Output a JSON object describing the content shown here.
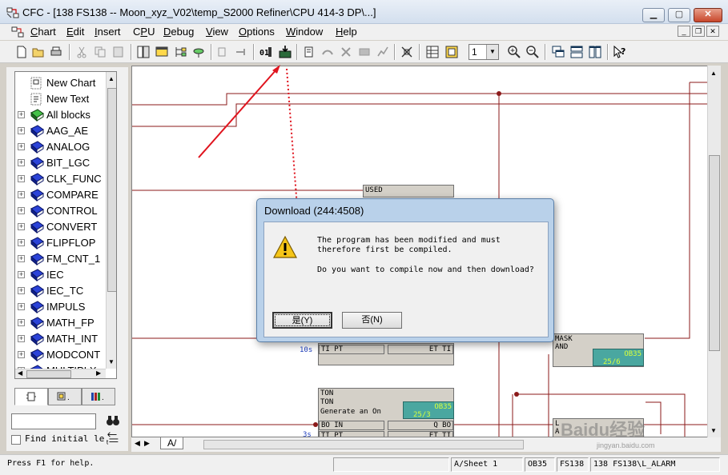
{
  "window": {
    "title": "CFC - [138 FS138 -- Moon_xyz_V02\\temp_S2000 Refiner\\CPU 414-3 DP\\...]",
    "minimize": "▁",
    "maximize": "▢",
    "close": "✕"
  },
  "menu": [
    {
      "label": "Chart",
      "ul": "C"
    },
    {
      "label": "Edit",
      "ul": "E"
    },
    {
      "label": "Insert",
      "ul": "I"
    },
    {
      "label": "CPU",
      "ul": "P"
    },
    {
      "label": "Debug",
      "ul": "D"
    },
    {
      "label": "View",
      "ul": "V"
    },
    {
      "label": "Options",
      "ul": "O"
    },
    {
      "label": "Window",
      "ul": "W"
    },
    {
      "label": "Help",
      "ul": "H"
    }
  ],
  "toolbar": {
    "zoom_select_value": "1",
    "icons": [
      "new-icon",
      "open-icon",
      "print-icon",
      "cut-icon",
      "copy-icon",
      "paste-icon",
      "catalog-icon",
      "overview-icon",
      "structure-icon",
      "link-icon",
      "connect-icon",
      "compile-icon",
      "download-icon",
      "monitor-icon",
      "test-icon",
      "zoom-in-icon",
      "zoom-out-icon",
      "cascade-icon",
      "tile-horizontal-icon",
      "tile-vertical-icon",
      "help-cursor-icon"
    ]
  },
  "tree": {
    "items": [
      {
        "label": "New Chart",
        "icon": "chart-icon",
        "expandable": false
      },
      {
        "label": "New Text",
        "icon": "text-icon",
        "expandable": false
      },
      {
        "label": "All blocks",
        "icon": "book-green-icon",
        "expandable": true
      },
      {
        "label": "AAG_AE",
        "icon": "book-blue-icon",
        "expandable": true
      },
      {
        "label": "ANALOG",
        "icon": "book-blue-icon",
        "expandable": true
      },
      {
        "label": "BIT_LGC",
        "icon": "book-blue-icon",
        "expandable": true
      },
      {
        "label": "CLK_FUNC",
        "icon": "book-blue-icon",
        "expandable": true
      },
      {
        "label": "COMPARE",
        "icon": "book-blue-icon",
        "expandable": true
      },
      {
        "label": "CONTROL",
        "icon": "book-blue-icon",
        "expandable": true
      },
      {
        "label": "CONVERT",
        "icon": "book-blue-icon",
        "expandable": true
      },
      {
        "label": "FLIPFLOP",
        "icon": "book-blue-icon",
        "expandable": true
      },
      {
        "label": "FM_CNT_1",
        "icon": "book-blue-icon",
        "expandable": true
      },
      {
        "label": "IEC",
        "icon": "book-blue-icon",
        "expandable": true
      },
      {
        "label": "IEC_TC",
        "icon": "book-blue-icon",
        "expandable": true
      },
      {
        "label": "IMPULS",
        "icon": "book-blue-icon",
        "expandable": true
      },
      {
        "label": "MATH_FP",
        "icon": "book-blue-icon",
        "expandable": true
      },
      {
        "label": "MATH_INT",
        "icon": "book-blue-icon",
        "expandable": true
      },
      {
        "label": "MODCONT",
        "icon": "book-blue-icon",
        "expandable": true
      },
      {
        "label": "MULTIPLX",
        "icon": "book-blue-icon",
        "expandable": true
      }
    ]
  },
  "find": {
    "input_value": "",
    "checkbox_label": "Find initial le"
  },
  "sheet_tab": "A/",
  "canvas": {
    "blocks": {
      "used": {
        "title": "USED"
      },
      "mask": {
        "title": "MASK",
        "sub": "AND",
        "run_label": "OB35",
        "run_seq": "25/6"
      },
      "ton": {
        "title": "TON",
        "sub": "TON",
        "desc": "Generate an On",
        "run_label": "OB35",
        "run_seq": "25/3",
        "pin_in": "BO IN",
        "pin_pt": "TI PT",
        "pin_q": "Q BO",
        "pin_et": "ET TI"
      },
      "upper_pins": {
        "left": "TI PT",
        "right": "ET TI",
        "time": "10s"
      },
      "lower_time": "3s",
      "bottom_block": {
        "line1": "L",
        "line2": "A"
      }
    }
  },
  "dialog": {
    "title": "Download (244:4508)",
    "line1": "The program has been modified and must",
    "line2": "therefore first be compiled.",
    "line3": "Do you want to compile now and then download?",
    "yes_label": "是(Y)",
    "no_label": "否(N)"
  },
  "status": {
    "help": "Press F1 for help.",
    "sheet": "A/Sheet 1",
    "ob": "OB35",
    "fs": "FS138",
    "path": "138 FS138\\L_ALARM"
  },
  "watermark": {
    "main": "Baidu经验",
    "sub": "jingyan.baidu.com"
  },
  "colors": {
    "wire": "#8b1a1a",
    "dialog_frame": "#b9d1ea",
    "annotation": "#e0141e"
  }
}
